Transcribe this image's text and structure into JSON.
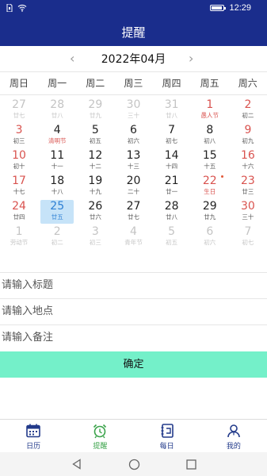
{
  "status": {
    "time": "12:29",
    "battery_level": 0.9
  },
  "header": {
    "title": "提醒"
  },
  "calendar": {
    "month_title": "2022年04月",
    "prev_arrow": "‹",
    "next_arrow": "›",
    "weekdays": [
      "周日",
      "周一",
      "周二",
      "周三",
      "周四",
      "周五",
      "周六"
    ],
    "colors": {
      "current": "#222222",
      "lunar": "#555555",
      "weekend": "#d9534f",
      "festival": "#d9534f",
      "other": "#c4c4c4",
      "selected_bg": "#c6e3f8",
      "selected_text": "#2c7fd4"
    },
    "weeks": [
      [
        {
          "d": "27",
          "l": "廿七",
          "t": "other"
        },
        {
          "d": "28",
          "l": "廿八",
          "t": "other"
        },
        {
          "d": "29",
          "l": "廿九",
          "t": "other"
        },
        {
          "d": "30",
          "l": "三十",
          "t": "other"
        },
        {
          "d": "31",
          "l": "廿八",
          "t": "other"
        },
        {
          "d": "1",
          "l": "愚人节",
          "t": "fest"
        },
        {
          "d": "2",
          "l": "初二",
          "t": "weekend"
        }
      ],
      [
        {
          "d": "3",
          "l": "初三",
          "t": "weekend"
        },
        {
          "d": "4",
          "l": "清明节",
          "t": "fest"
        },
        {
          "d": "5",
          "l": "初五",
          "t": "cur"
        },
        {
          "d": "6",
          "l": "初六",
          "t": "cur"
        },
        {
          "d": "7",
          "l": "初七",
          "t": "cur"
        },
        {
          "d": "8",
          "l": "初八",
          "t": "cur"
        },
        {
          "d": "9",
          "l": "初九",
          "t": "weekend"
        }
      ],
      [
        {
          "d": "10",
          "l": "初十",
          "t": "weekend"
        },
        {
          "d": "11",
          "l": "十一",
          "t": "cur"
        },
        {
          "d": "12",
          "l": "十二",
          "t": "cur"
        },
        {
          "d": "13",
          "l": "十三",
          "t": "cur"
        },
        {
          "d": "14",
          "l": "十四",
          "t": "cur"
        },
        {
          "d": "15",
          "l": "十五",
          "t": "cur"
        },
        {
          "d": "16",
          "l": "十六",
          "t": "weekend"
        }
      ],
      [
        {
          "d": "17",
          "l": "十七",
          "t": "weekend"
        },
        {
          "d": "18",
          "l": "十八",
          "t": "cur"
        },
        {
          "d": "19",
          "l": "十九",
          "t": "cur"
        },
        {
          "d": "20",
          "l": "二十",
          "t": "cur"
        },
        {
          "d": "21",
          "l": "廿一",
          "t": "cur"
        },
        {
          "d": "22",
          "l": "生日",
          "t": "fest",
          "dot": true
        },
        {
          "d": "23",
          "l": "廿三",
          "t": "weekend"
        }
      ],
      [
        {
          "d": "24",
          "l": "廿四",
          "t": "weekend"
        },
        {
          "d": "25",
          "l": "廿五",
          "t": "sel"
        },
        {
          "d": "26",
          "l": "廿六",
          "t": "cur"
        },
        {
          "d": "27",
          "l": "廿七",
          "t": "cur"
        },
        {
          "d": "28",
          "l": "廿八",
          "t": "cur"
        },
        {
          "d": "29",
          "l": "廿九",
          "t": "cur"
        },
        {
          "d": "30",
          "l": "三十",
          "t": "weekend"
        }
      ],
      [
        {
          "d": "1",
          "l": "劳动节",
          "t": "other"
        },
        {
          "d": "2",
          "l": "初二",
          "t": "other"
        },
        {
          "d": "3",
          "l": "初三",
          "t": "other"
        },
        {
          "d": "4",
          "l": "青年节",
          "t": "other"
        },
        {
          "d": "5",
          "l": "初五",
          "t": "other"
        },
        {
          "d": "6",
          "l": "初六",
          "t": "other"
        },
        {
          "d": "7",
          "l": "初七",
          "t": "other"
        }
      ]
    ]
  },
  "form": {
    "title_placeholder": "请输入标题",
    "location_placeholder": "请输入地点",
    "notes_placeholder": "请输入备注",
    "confirm_label": "确定",
    "confirm_color": "#74f0c9"
  },
  "tabs": [
    {
      "label": "日历",
      "icon": "calendar-icon",
      "active": false
    },
    {
      "label": "提醒",
      "icon": "alarm-clock-icon",
      "active": true
    },
    {
      "label": "每日",
      "icon": "daily-notebook-icon",
      "active": false
    },
    {
      "label": "我的",
      "icon": "user-icon",
      "active": false
    }
  ]
}
